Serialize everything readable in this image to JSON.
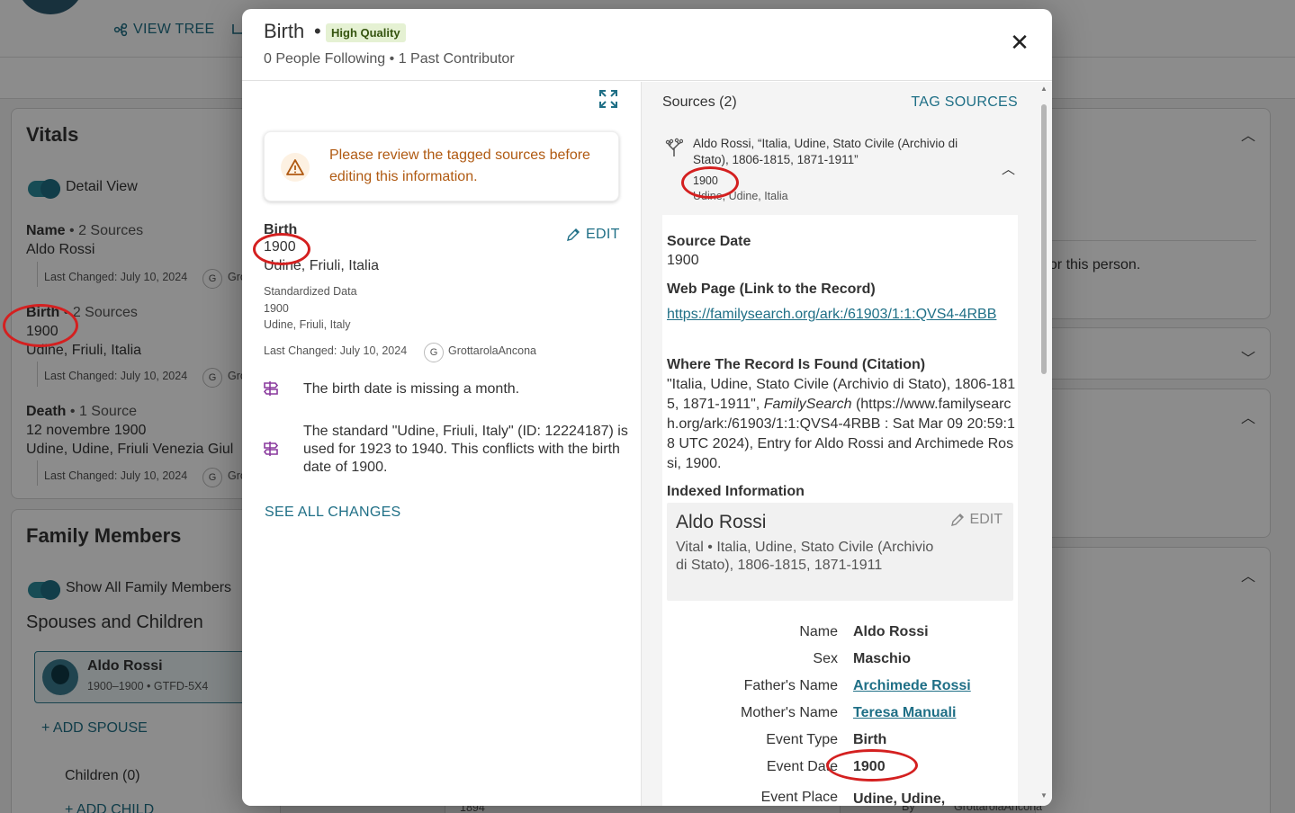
{
  "background": {
    "nav_view_tree": "VIEW TREE",
    "vitals": {
      "title": "Vitals",
      "detail_view": "Detail View",
      "name_label": "Name",
      "name_sources": "• 2 Sources",
      "name_value": "Aldo Rossi",
      "birth_label": "Birth",
      "birth_sources": "• 2 Sources",
      "birth_date": "1900",
      "birth_place": "Udine, Friuli, Italia",
      "death_label": "Death",
      "death_sources": "• 1 Source",
      "death_date": "12 novembre 1900",
      "death_place": "Udine, Udine, Friuli Venezia Giul",
      "last_changed": "Last Changed: July 10, 2024",
      "contributor_initial": "G",
      "contributor_partial": "Gro"
    },
    "family": {
      "title": "Family Members",
      "show_all": "Show All Family Members",
      "spouses_children": "Spouses and Children",
      "person_name": "Aldo Rossi",
      "person_meta": "1900–1900 • GTFD-5X4",
      "add_spouse": "+ ADD SPOUSE",
      "children": "Children (0)",
      "add_child": "+ ADD CHILD"
    },
    "right_panel_text": "s for this person.",
    "bottom_fragment": "1894",
    "bottom_by": "By",
    "bottom_contributor": "GrottarolaAncona"
  },
  "modal": {
    "title": "Birth",
    "badge": "High Quality",
    "subtitle": "0 People Following • 1 Past Contributor",
    "warning": "Please review the tagged sources before editing this information.",
    "event_label": "Birth",
    "event_date": "1900",
    "event_place": "Udine, Friuli, Italia",
    "edit": "EDIT",
    "standardized_label": "Standardized Data",
    "std_date": "1900",
    "std_place": "Udine, Friuli, Italy",
    "last_changed": "Last Changed: July 10, 2024",
    "contributor_initial": "G",
    "contributor": "GrottarolaAncona",
    "issue1": "The birth date is missing a month.",
    "issue2": "The standard \"Udine, Friuli, Italy\" (ID: 12224187) is used for 1923 to 1940. This conflicts with the birth date of 1900.",
    "see_all": "SEE ALL CHANGES",
    "sources": {
      "title": "Sources (2)",
      "tag": "TAG SOURCES",
      "src_title": "Aldo Rossi, “Italia, Udine, Stato Civile (Archivio di Stato), 1806-1815, 1871-1911”",
      "src_date": "1900",
      "src_place": "Udine, Udine, Italia",
      "source_date_label": "Source Date",
      "source_date": "1900",
      "web_label": "Web Page (Link to the Record)",
      "web_url": "https://familysearch.org/ark:/61903/1:1:QVS4-4RBB",
      "citation_label": "Where The Record Is Found (Citation)",
      "citation_pre": "\"Italia, Udine, Stato Civile (Archivio di Stato), 1806-1815, 1871-1911\", ",
      "citation_italic": "FamilySearch",
      "citation_post": " (https://www.familysearch.org/ark:/61903/1:1:QVS4-4RBB : Sat Mar 09 20:59:18 UTC 2024), Entry for Aldo Rossi and Archimede Rossi, 1900.",
      "indexed_label": "Indexed Information",
      "idx_name": "Aldo Rossi",
      "idx_edit": "EDIT",
      "idx_sub": "Vital • Italia, Udine, Stato Civile (Archivio di Stato), 1806-1815, 1871-1911",
      "fields": [
        {
          "k": "Name",
          "v": "Aldo Rossi"
        },
        {
          "k": "Sex",
          "v": "Maschio"
        },
        {
          "k": "Father's Name",
          "v": "Archimede Rossi"
        },
        {
          "k": "Mother's Name",
          "v": "Teresa Manuali"
        },
        {
          "k": "Event Type",
          "v": "Birth"
        },
        {
          "k": "Event Date",
          "v": "1900"
        },
        {
          "k": "Event Place",
          "v": "Udine, Udine,"
        }
      ]
    }
  },
  "colors": {
    "accent": "#1f6f86",
    "warning": "#b05a12",
    "badge_bg": "#e5f1d3",
    "annotation": "#d42020"
  }
}
